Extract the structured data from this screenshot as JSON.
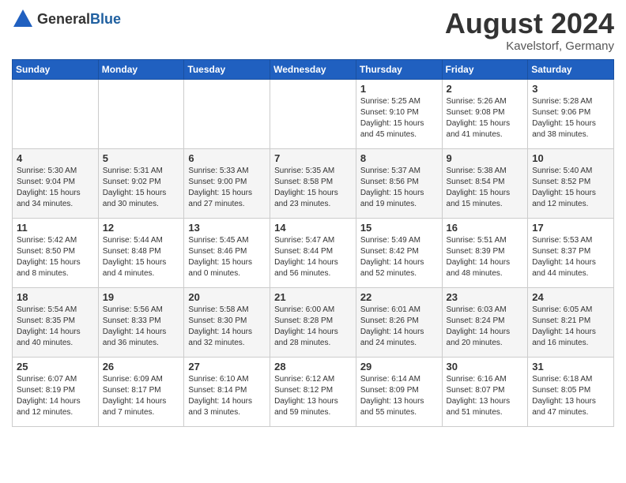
{
  "header": {
    "logo_general": "General",
    "logo_blue": "Blue",
    "month": "August 2024",
    "location": "Kavelstorf, Germany"
  },
  "days_of_week": [
    "Sunday",
    "Monday",
    "Tuesday",
    "Wednesday",
    "Thursday",
    "Friday",
    "Saturday"
  ],
  "weeks": [
    [
      {
        "day": "",
        "info": ""
      },
      {
        "day": "",
        "info": ""
      },
      {
        "day": "",
        "info": ""
      },
      {
        "day": "",
        "info": ""
      },
      {
        "day": "1",
        "info": "Sunrise: 5:25 AM\nSunset: 9:10 PM\nDaylight: 15 hours\nand 45 minutes."
      },
      {
        "day": "2",
        "info": "Sunrise: 5:26 AM\nSunset: 9:08 PM\nDaylight: 15 hours\nand 41 minutes."
      },
      {
        "day": "3",
        "info": "Sunrise: 5:28 AM\nSunset: 9:06 PM\nDaylight: 15 hours\nand 38 minutes."
      }
    ],
    [
      {
        "day": "4",
        "info": "Sunrise: 5:30 AM\nSunset: 9:04 PM\nDaylight: 15 hours\nand 34 minutes."
      },
      {
        "day": "5",
        "info": "Sunrise: 5:31 AM\nSunset: 9:02 PM\nDaylight: 15 hours\nand 30 minutes."
      },
      {
        "day": "6",
        "info": "Sunrise: 5:33 AM\nSunset: 9:00 PM\nDaylight: 15 hours\nand 27 minutes."
      },
      {
        "day": "7",
        "info": "Sunrise: 5:35 AM\nSunset: 8:58 PM\nDaylight: 15 hours\nand 23 minutes."
      },
      {
        "day": "8",
        "info": "Sunrise: 5:37 AM\nSunset: 8:56 PM\nDaylight: 15 hours\nand 19 minutes."
      },
      {
        "day": "9",
        "info": "Sunrise: 5:38 AM\nSunset: 8:54 PM\nDaylight: 15 hours\nand 15 minutes."
      },
      {
        "day": "10",
        "info": "Sunrise: 5:40 AM\nSunset: 8:52 PM\nDaylight: 15 hours\nand 12 minutes."
      }
    ],
    [
      {
        "day": "11",
        "info": "Sunrise: 5:42 AM\nSunset: 8:50 PM\nDaylight: 15 hours\nand 8 minutes."
      },
      {
        "day": "12",
        "info": "Sunrise: 5:44 AM\nSunset: 8:48 PM\nDaylight: 15 hours\nand 4 minutes."
      },
      {
        "day": "13",
        "info": "Sunrise: 5:45 AM\nSunset: 8:46 PM\nDaylight: 15 hours\nand 0 minutes."
      },
      {
        "day": "14",
        "info": "Sunrise: 5:47 AM\nSunset: 8:44 PM\nDaylight: 14 hours\nand 56 minutes."
      },
      {
        "day": "15",
        "info": "Sunrise: 5:49 AM\nSunset: 8:42 PM\nDaylight: 14 hours\nand 52 minutes."
      },
      {
        "day": "16",
        "info": "Sunrise: 5:51 AM\nSunset: 8:39 PM\nDaylight: 14 hours\nand 48 minutes."
      },
      {
        "day": "17",
        "info": "Sunrise: 5:53 AM\nSunset: 8:37 PM\nDaylight: 14 hours\nand 44 minutes."
      }
    ],
    [
      {
        "day": "18",
        "info": "Sunrise: 5:54 AM\nSunset: 8:35 PM\nDaylight: 14 hours\nand 40 minutes."
      },
      {
        "day": "19",
        "info": "Sunrise: 5:56 AM\nSunset: 8:33 PM\nDaylight: 14 hours\nand 36 minutes."
      },
      {
        "day": "20",
        "info": "Sunrise: 5:58 AM\nSunset: 8:30 PM\nDaylight: 14 hours\nand 32 minutes."
      },
      {
        "day": "21",
        "info": "Sunrise: 6:00 AM\nSunset: 8:28 PM\nDaylight: 14 hours\nand 28 minutes."
      },
      {
        "day": "22",
        "info": "Sunrise: 6:01 AM\nSunset: 8:26 PM\nDaylight: 14 hours\nand 24 minutes."
      },
      {
        "day": "23",
        "info": "Sunrise: 6:03 AM\nSunset: 8:24 PM\nDaylight: 14 hours\nand 20 minutes."
      },
      {
        "day": "24",
        "info": "Sunrise: 6:05 AM\nSunset: 8:21 PM\nDaylight: 14 hours\nand 16 minutes."
      }
    ],
    [
      {
        "day": "25",
        "info": "Sunrise: 6:07 AM\nSunset: 8:19 PM\nDaylight: 14 hours\nand 12 minutes."
      },
      {
        "day": "26",
        "info": "Sunrise: 6:09 AM\nSunset: 8:17 PM\nDaylight: 14 hours\nand 7 minutes."
      },
      {
        "day": "27",
        "info": "Sunrise: 6:10 AM\nSunset: 8:14 PM\nDaylight: 14 hours\nand 3 minutes."
      },
      {
        "day": "28",
        "info": "Sunrise: 6:12 AM\nSunset: 8:12 PM\nDaylight: 13 hours\nand 59 minutes."
      },
      {
        "day": "29",
        "info": "Sunrise: 6:14 AM\nSunset: 8:09 PM\nDaylight: 13 hours\nand 55 minutes."
      },
      {
        "day": "30",
        "info": "Sunrise: 6:16 AM\nSunset: 8:07 PM\nDaylight: 13 hours\nand 51 minutes."
      },
      {
        "day": "31",
        "info": "Sunrise: 6:18 AM\nSunset: 8:05 PM\nDaylight: 13 hours\nand 47 minutes."
      }
    ]
  ]
}
